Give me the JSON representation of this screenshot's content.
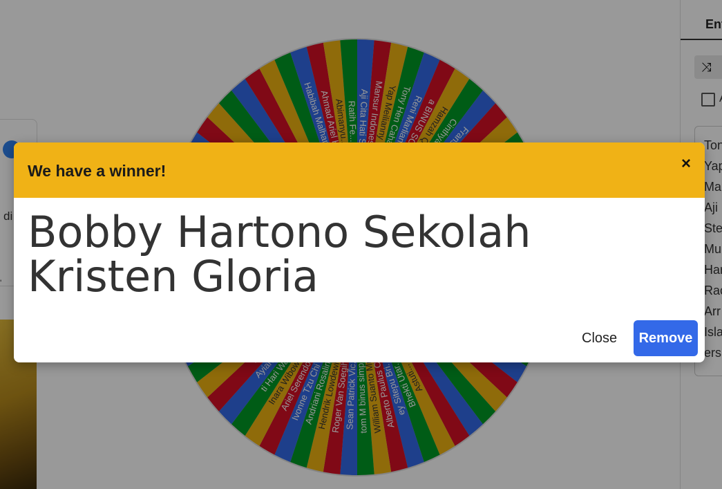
{
  "page": {
    "left_text": "di",
    "right_panel": {
      "tab_label": "Ent",
      "checkbox_label": "A",
      "entries": [
        "Ton",
        "Yap",
        "Ma",
        "Aji",
        "Ste",
        "Mu",
        "Har",
        "Rac",
        "Arr",
        "Isla",
        "ers"
      ]
    }
  },
  "wheel": {
    "colors": [
      "#3369e8",
      "#d50f25",
      "#eeb211",
      "#009925"
    ],
    "top_labels": [
      "Aji Cita Hati Sdy",
      "Mansur Indonesian...",
      "Yap Meilianny Tun...",
      "Tony Hen Cahaya B...",
      "Reni Marliani BIN...",
      "a BINUS SCHOOL...",
      "Hamzah Qurrotul A...",
      "Cinthya Rizky Ku...",
      "Fransisca Andrian...",
      "Jun Sugi Wi...",
      "Sc..."
    ],
    "top_left_labels": [
      "Habibah Malhamud S...",
      "Ahmad Ariel Ku...",
      "Abimanyu...",
      "Ratih Fe..."
    ],
    "bottom_labels": [
      "Ariel Serendo St...",
      "Ivonne Tzu Chi Sc...",
      "Andriani Rosalina...",
      "Hendrik Lowdewik...",
      "Roger Van Soegihi...",
      "Sean Patrick Vic...",
      "tom M binus simpr...",
      "William Suanto Mu...",
      "Alberto Paulus Cl...",
      "ey Sitepu Bri...",
      "Bhekti Utar...",
      "Astuti..."
    ],
    "bottom_left_labels": [
      "Inara Wibowo Pu...",
      "ti Hari Wardan...",
      "Ayianti Sek...",
      "won Ra..."
    ]
  },
  "modal": {
    "title": "We have a winner!",
    "close_icon": "×",
    "winner": "Bobby Hartono Sekolah Kristen Gloria",
    "close_label": "Close",
    "remove_label": "Remove",
    "header_color": "#f0b216",
    "remove_color": "#3369e8"
  }
}
